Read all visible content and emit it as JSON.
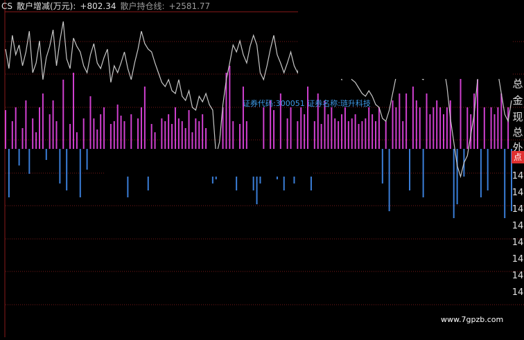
{
  "header": {
    "prefix": "CS",
    "ind1_name": "散户增减(万元):",
    "ind1_value": "+802.34",
    "ind2_name": "散户持仓线:",
    "ind2_value": "+2581.77",
    "colors": {
      "prefix": "#e0e0e0",
      "ind1": "#e0e0e0",
      "value": "#e0e0e0",
      "ind2": "#9a9a9a"
    }
  },
  "caption": {
    "code_label": "证券代码:",
    "code_value": "300051",
    "name_label": "证券名称:",
    "name_value": "琏升科技",
    "color": "#3d9ae8"
  },
  "right_panel": {
    "chars": [
      "总",
      "金",
      "现",
      "总",
      "外"
    ],
    "badge": "点",
    "numbers": [
      "14",
      "14",
      "14",
      "14",
      "14",
      "14",
      "14",
      "14"
    ]
  },
  "watermark": "www.7gpzb.com",
  "chart_data": {
    "type": "bar",
    "n": 150,
    "series": [
      {
        "name": "散户增减(万元)",
        "colors": {
          "positive": "#d040d0",
          "negative": "#3a7ed8"
        },
        "values": [
          0.28,
          -0.35,
          0.2,
          0.3,
          -0.12,
          0.15,
          0.35,
          -0.18,
          0.22,
          0.12,
          0.3,
          0.4,
          -0.08,
          0.25,
          0.35,
          0.2,
          -0.25,
          0.5,
          -0.3,
          0.18,
          0.55,
          0.12,
          -0.35,
          0.22,
          -0.15,
          0.38,
          0.22,
          0.14,
          0.25,
          0.3,
          -0.12,
          0.18,
          0.2,
          0.32,
          0.24,
          0.2,
          -0.35,
          0.25,
          -0.2,
          0.22,
          0.3,
          0.45,
          -0.3,
          0.18,
          0.12,
          -0.15,
          0.22,
          0.2,
          0.25,
          0.18,
          0.3,
          0.22,
          0.2,
          0.15,
          0.28,
          0.12,
          0.22,
          0.2,
          0.25,
          0.15,
          -0.2,
          -0.25,
          -0.22,
          -0.18,
          0.3,
          0.55,
          0.6,
          0.2,
          -0.3,
          0.18,
          0.45,
          0.2,
          -0.15,
          -0.3,
          -0.4,
          -0.25,
          0.3,
          -0.2,
          0.35,
          0.28,
          -0.22,
          0.4,
          -0.3,
          0.22,
          0.3,
          -0.25,
          0.2,
          0.3,
          0.25,
          0.45,
          -0.3,
          0.2,
          0.4,
          0.18,
          0.35,
          0.25,
          0.3,
          0.22,
          0.2,
          0.25,
          0.3,
          0.2,
          0.22,
          0.25,
          0.18,
          0.2,
          0.22,
          0.3,
          0.25,
          0.2,
          0.3,
          -0.25,
          0.2,
          -0.45,
          0.35,
          0.3,
          0.4,
          0.2,
          0.4,
          -0.3,
          0.45,
          0.35,
          0.3,
          -0.35,
          0.4,
          0.25,
          0.3,
          0.35,
          0.3,
          0.25,
          0.3,
          0.35,
          -0.5,
          -0.4,
          0.6,
          -0.2,
          0.3,
          0.25,
          0.4,
          0.5,
          -0.35,
          0.3,
          -0.3,
          0.3,
          0.25,
          0.3,
          0.4,
          -0.5,
          0.3,
          -0.45
        ]
      },
      {
        "name": "散户持仓线",
        "color": "#c8c8c8",
        "values": [
          0.72,
          0.58,
          0.82,
          0.68,
          0.75,
          0.6,
          0.7,
          0.85,
          0.55,
          0.62,
          0.78,
          0.5,
          0.66,
          0.74,
          0.86,
          0.6,
          0.78,
          0.92,
          0.65,
          0.58,
          0.8,
          0.74,
          0.7,
          0.6,
          0.55,
          0.68,
          0.76,
          0.62,
          0.58,
          0.66,
          0.72,
          0.48,
          0.6,
          0.55,
          0.62,
          0.7,
          0.58,
          0.5,
          0.62,
          0.72,
          0.85,
          0.76,
          0.72,
          0.7,
          0.62,
          0.55,
          0.48,
          0.45,
          0.5,
          0.42,
          0.4,
          0.5,
          0.38,
          0.35,
          0.42,
          0.3,
          0.28,
          0.38,
          0.34,
          0.4,
          0.32,
          0.28,
          -0.05,
          0.05,
          0.32,
          0.5,
          0.62,
          0.75,
          0.7,
          0.78,
          0.68,
          0.62,
          0.74,
          0.82,
          0.75,
          0.55,
          0.5,
          0.6,
          0.72,
          0.82,
          0.68,
          0.62,
          0.55,
          0.62,
          0.7,
          0.6,
          0.55,
          0.65,
          0.72,
          0.75,
          0.68,
          0.72,
          0.66,
          0.78,
          0.85,
          0.72,
          0.68,
          0.62,
          0.55,
          0.5,
          0.6,
          0.55,
          0.5,
          0.48,
          0.44,
          0.4,
          0.38,
          0.42,
          0.38,
          0.32,
          0.3,
          0.22,
          0.2,
          0.28,
          0.4,
          0.52,
          0.64,
          0.72,
          0.66,
          0.6,
          0.55,
          0.62,
          0.52,
          0.5,
          0.55,
          0.68,
          0.78,
          0.85,
          0.72,
          0.6,
          0.45,
          0.22,
          0.05,
          -0.12,
          -0.2,
          -0.1,
          -0.05,
          0.1,
          0.25,
          0.5,
          0.62,
          0.7,
          0.78,
          0.82,
          0.72,
          0.55,
          0.4,
          0.25,
          0.2,
          0.35
        ]
      }
    ]
  }
}
